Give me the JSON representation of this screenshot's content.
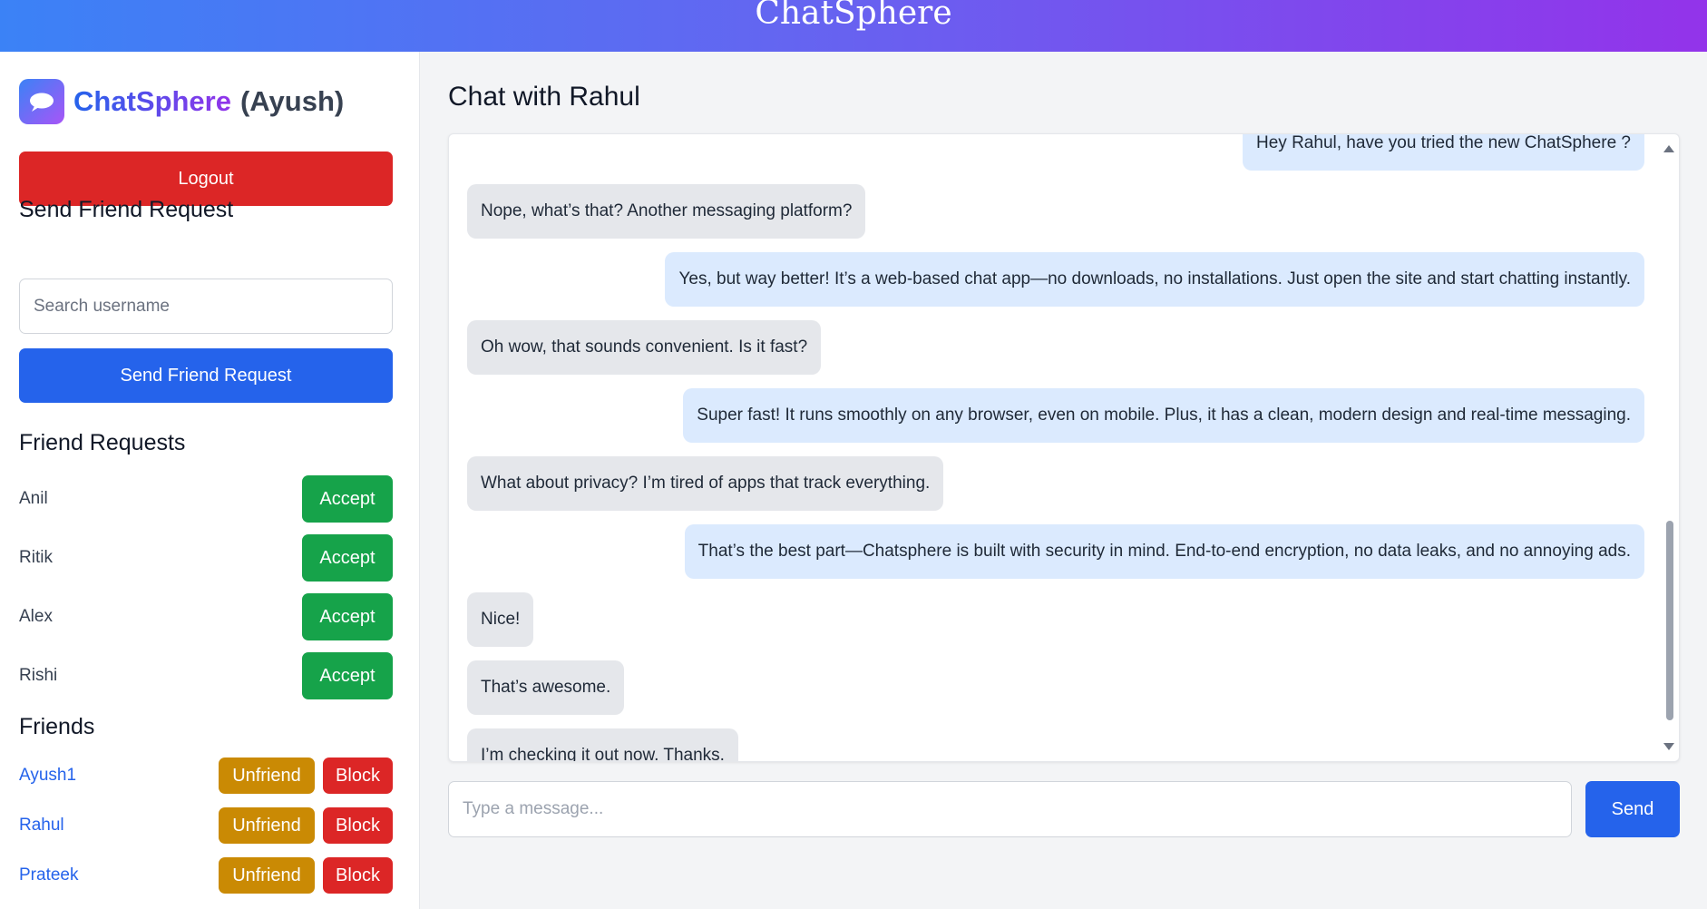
{
  "app": {
    "title": "ChatSphere"
  },
  "sidebar": {
    "brand_name": "ChatSphere",
    "current_user": "(Ayush)",
    "logout_label": "Logout",
    "send_request_title": "Send Friend Request",
    "search_placeholder": "Search username",
    "send_request_button": "Send Friend Request",
    "friend_requests_title": "Friend Requests",
    "friend_requests": [
      {
        "name": "Anil",
        "accept_label": "Accept"
      },
      {
        "name": "Ritik",
        "accept_label": "Accept"
      },
      {
        "name": "Alex",
        "accept_label": "Accept"
      },
      {
        "name": "Rishi",
        "accept_label": "Accept"
      }
    ],
    "friends_title": "Friends",
    "friends": [
      {
        "name": "Ayush1",
        "unfriend_label": "Unfriend",
        "block_label": "Block"
      },
      {
        "name": "Rahul",
        "unfriend_label": "Unfriend",
        "block_label": "Block"
      },
      {
        "name": "Prateek",
        "unfriend_label": "Unfriend",
        "block_label": "Block"
      }
    ]
  },
  "chat": {
    "title": "Chat with Rahul",
    "messages": [
      {
        "direction": "sent",
        "text": "Hey Rahul, have you tried the new ChatSphere ?"
      },
      {
        "direction": "received",
        "text": "Nope, what’s that? Another messaging platform?"
      },
      {
        "direction": "sent",
        "text": "Yes, but way better! It’s a web-based chat app—no downloads, no installations. Just open the site and start chatting instantly."
      },
      {
        "direction": "received",
        "text": "Oh wow, that sounds convenient. Is it fast?"
      },
      {
        "direction": "sent",
        "text": "Super fast! It runs smoothly on any browser, even on mobile. Plus, it has a clean, modern design and real-time messaging."
      },
      {
        "direction": "received",
        "text": "What about privacy? I’m tired of apps that track everything."
      },
      {
        "direction": "sent",
        "text": "That’s the best part—Chatsphere is built with security in mind. End-to-end encryption, no data leaks, and no annoying ads."
      },
      {
        "direction": "received",
        "text": "Nice!"
      },
      {
        "direction": "received",
        "text": "That’s awesome."
      },
      {
        "direction": "received",
        "text": "I’m checking it out now. Thanks."
      }
    ],
    "input_placeholder": "Type a message...",
    "send_label": "Send"
  },
  "colors": {
    "primary": "#2563eb",
    "danger": "#dc2626",
    "success": "#16a34a",
    "warning": "#ca8a04",
    "received_bubble": "#e5e7eb",
    "sent_bubble": "#dbeafe"
  },
  "icons": {
    "logo": "chat-bubble-icon"
  }
}
